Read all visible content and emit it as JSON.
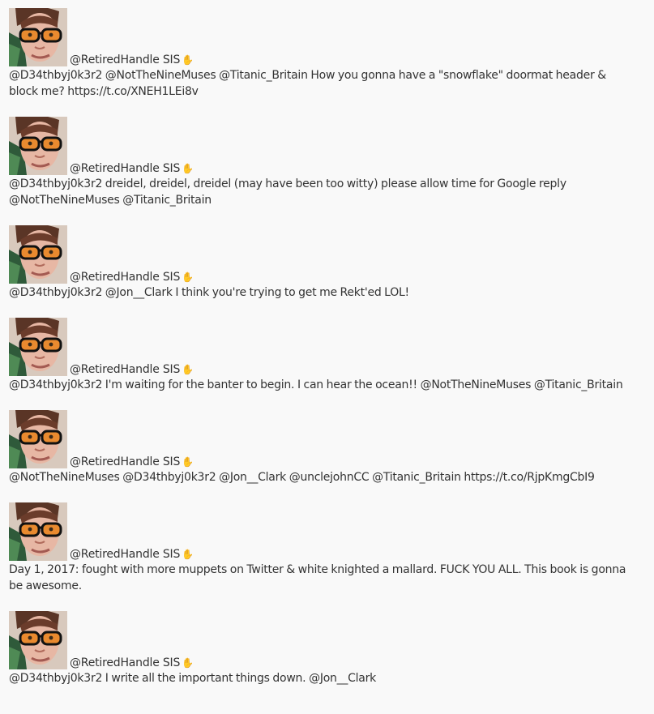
{
  "feed": {
    "tweets": [
      {
        "author": "@RetiredHandle SIS",
        "icon": "waving-hand-icon",
        "text": "@D34thbyj0k3r2 @NotTheNineMuses @Titanic_Britain How you gonna have a \"snowflake\" doormat header & block me? https://t.co/XNEH1LEi8v"
      },
      {
        "author": "@RetiredHandle SIS",
        "icon": "waving-hand-icon",
        "text": "@D34thbyj0k3r2 dreidel, dreidel, dreidel (may have been too witty) please allow time for Google reply @NotTheNineMuses @Titanic_Britain"
      },
      {
        "author": "@RetiredHandle SIS",
        "icon": "waving-hand-icon",
        "text": "@D34thbyj0k3r2 @Jon__Clark I think you're trying to get me Rekt'ed LOL!"
      },
      {
        "author": "@RetiredHandle SIS",
        "icon": "waving-hand-icon",
        "text": "@D34thbyj0k3r2 I'm waiting for the banter to begin. I can hear the ocean!! @NotTheNineMuses @Titanic_Britain"
      },
      {
        "author": "@RetiredHandle SIS",
        "icon": "waving-hand-icon",
        "text": "@NotTheNineMuses @D34thbyj0k3r2 @Jon__Clark @unclejohnCC @Titanic_Britain https://t.co/RjpKmgCbI9"
      },
      {
        "author": "@RetiredHandle SIS",
        "icon": "waving-hand-icon",
        "text": "Day 1, 2017: fought with more muppets on Twitter & white knighted a mallard. FUCK YOU ALL. This book is gonna be awesome."
      },
      {
        "author": "@RetiredHandle SIS",
        "icon": "waving-hand-icon",
        "text": "@D34thbyj0k3r2 I write all the important things down. @Jon__Clark"
      }
    ]
  }
}
